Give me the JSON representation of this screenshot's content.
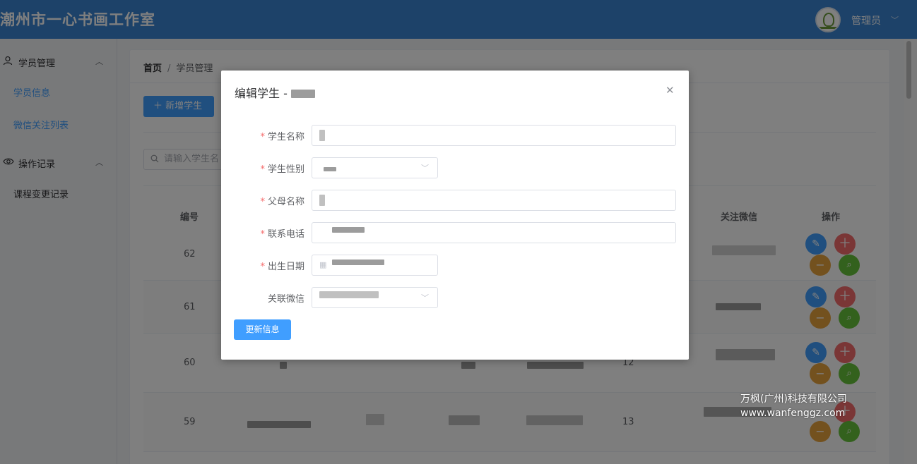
{
  "app": {
    "title": "潮州市一心书画工作室",
    "user": "管理员"
  },
  "sidebar": {
    "groups": [
      {
        "label": "学员管理",
        "icon": "user-icon",
        "items": [
          "学员信息",
          "微信关注列表"
        ]
      },
      {
        "label": "操作记录",
        "icon": "eye-icon",
        "items": [
          "课程变更记录"
        ]
      }
    ]
  },
  "breadcrumb": {
    "home": "首页",
    "separator": "/",
    "current": "学员管理"
  },
  "toolbar": {
    "add_label": "新增学生"
  },
  "search": {
    "placeholder": "请输入学生名"
  },
  "table": {
    "headers": {
      "id": "编号",
      "wechat": "关注微信",
      "actions": "操作"
    },
    "rows": [
      {
        "id": "62",
        "num": ""
      },
      {
        "id": "61",
        "num": ""
      },
      {
        "id": "60",
        "num": "12"
      },
      {
        "id": "59",
        "num": "13"
      }
    ]
  },
  "dialog": {
    "title": "编辑学生 - ",
    "fields": [
      {
        "label": "学生名称",
        "required": true
      },
      {
        "label": "学生性别",
        "required": true
      },
      {
        "label": "父母名称",
        "required": true
      },
      {
        "label": "联系电话",
        "required": true
      },
      {
        "label": "出生日期",
        "required": true
      },
      {
        "label": "关联微信",
        "required": false
      }
    ],
    "update_label": "更新信息"
  },
  "watermark": {
    "line1": "万枫(广州)科技有限公司",
    "line2": "www.wanfenggz.com"
  },
  "colors": {
    "header": "#3a85d3",
    "primary": "#409eff",
    "danger": "#f56c6c",
    "warning": "#e6a23c",
    "success": "#67c23a"
  }
}
